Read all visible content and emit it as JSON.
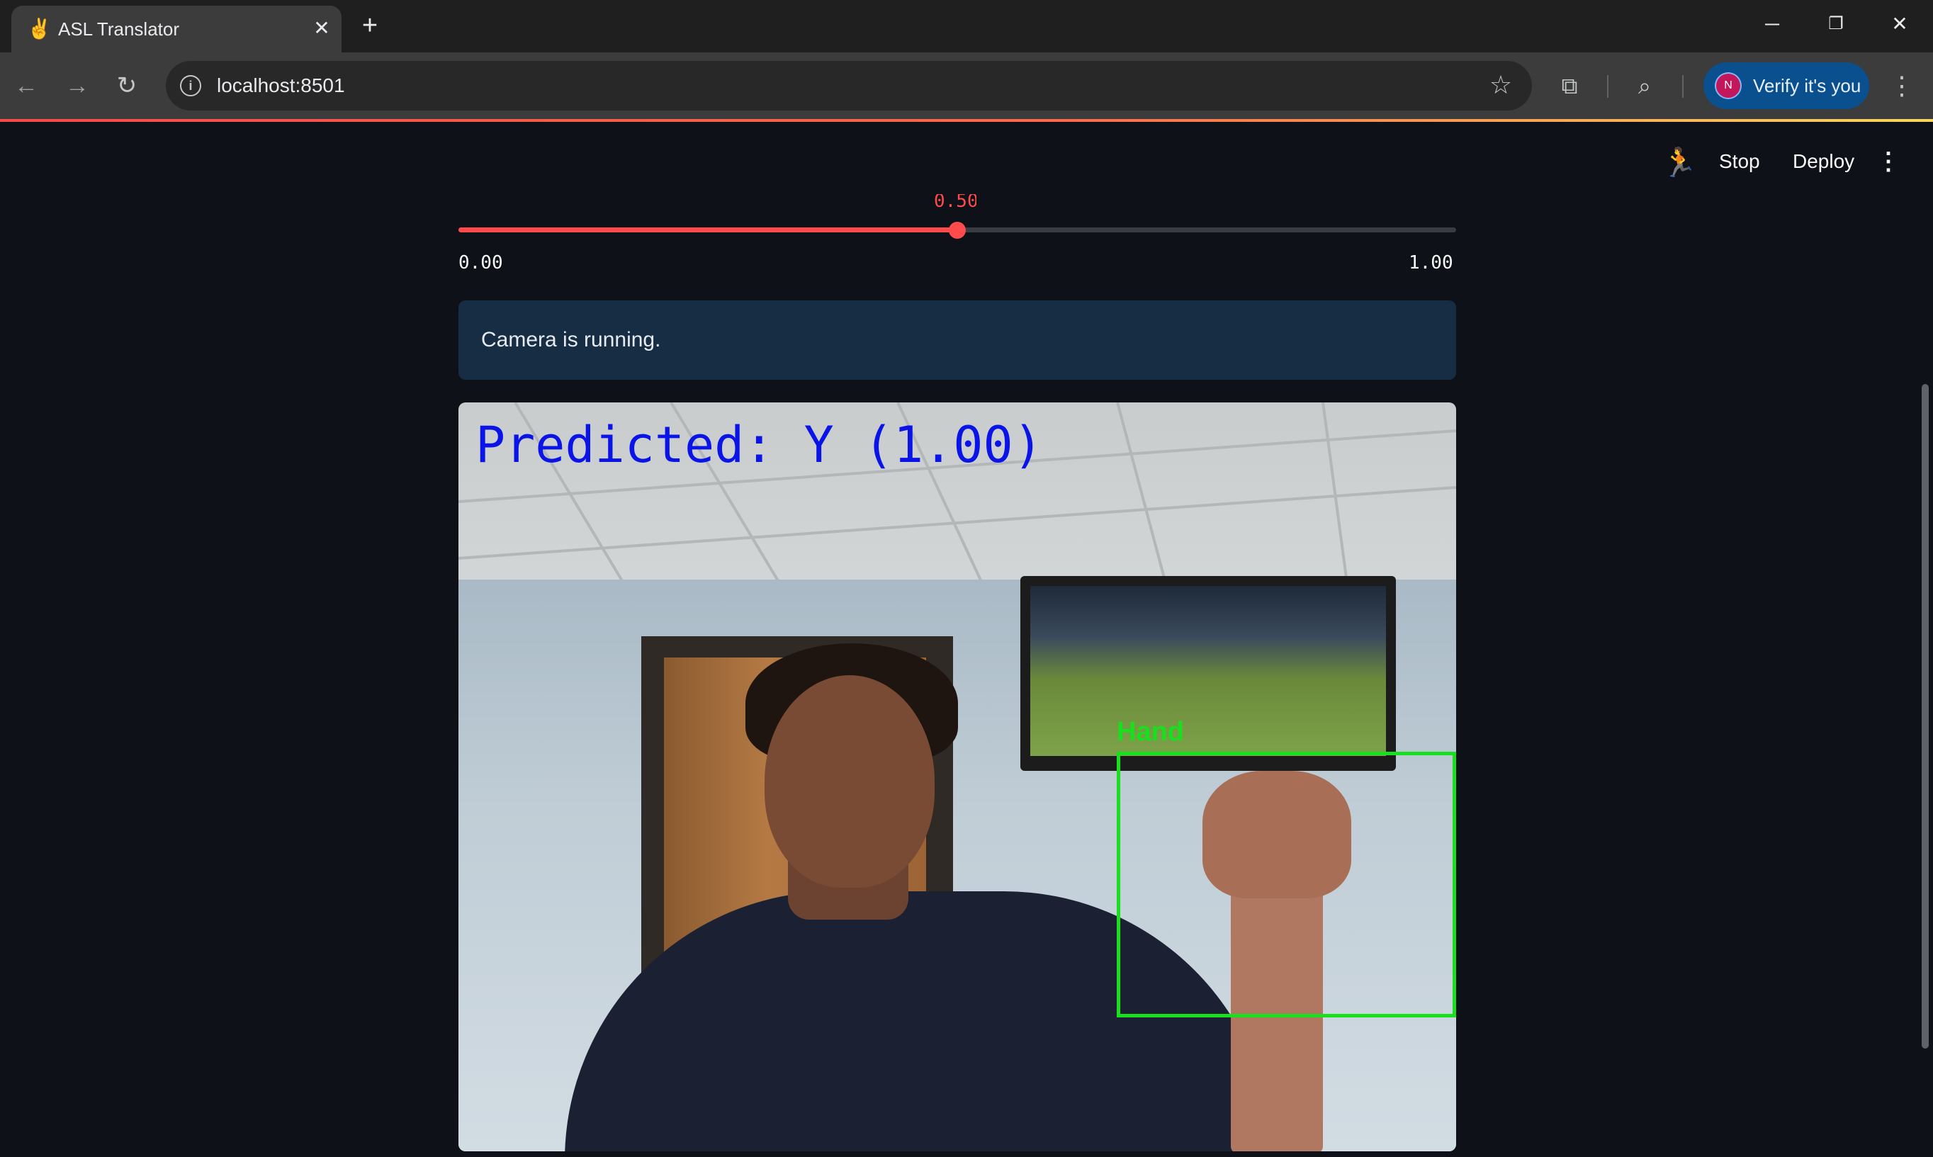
{
  "browser": {
    "tab_title": "ASL Translator",
    "favicon_icon": "waving-hand-icon",
    "url": "localhost:8501",
    "profile_initial": "N",
    "verify_label": "Verify it's you"
  },
  "app_header": {
    "stop_label": "Stop",
    "deploy_label": "Deploy"
  },
  "slider": {
    "value_label": "0.50",
    "value": 0.5,
    "min_label": "0.00",
    "max_label": "1.00",
    "accent_color": "#ff4b4b"
  },
  "alert": {
    "text": "Camera is running.",
    "background_color": "#172d43"
  },
  "camera_frame": {
    "predicted_text": "Predicted: Y (1.00)",
    "detection_label": "Hand",
    "detection_color": "#19e01e"
  }
}
